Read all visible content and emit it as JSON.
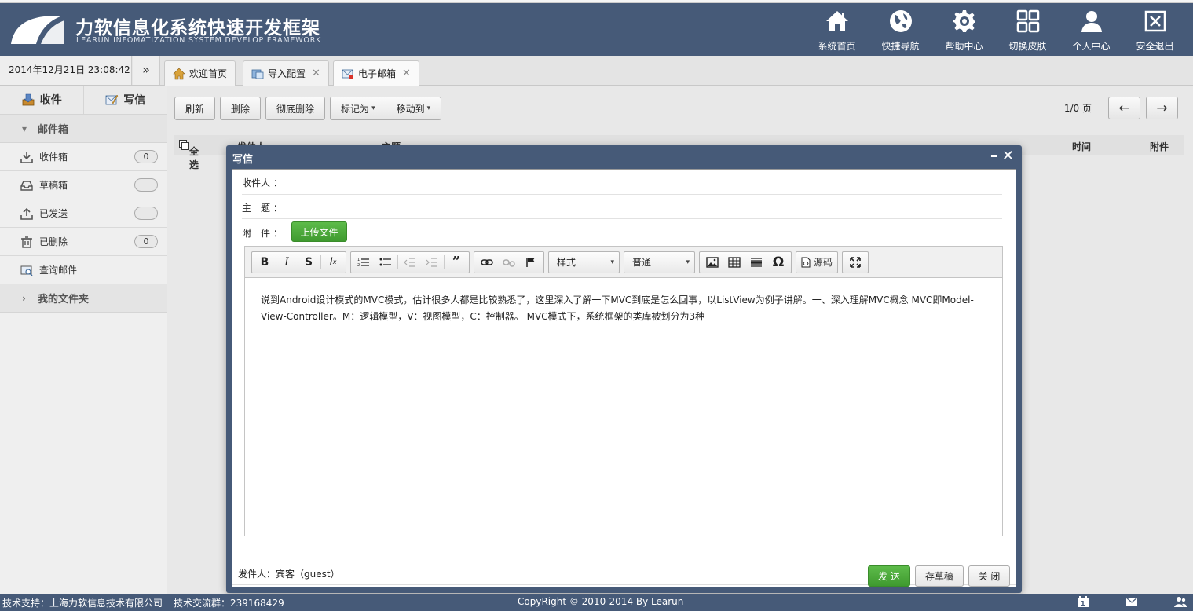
{
  "app": {
    "title_cn": "力软信息化系统快速开发框架",
    "title_en": "LEARUN INFOMATIZATION SYSTEM DEVELOP FRAMEWORK"
  },
  "nav": [
    {
      "label": "系统首页",
      "icon": "home-icon"
    },
    {
      "label": "快捷导航",
      "icon": "globe-icon"
    },
    {
      "label": "帮助中心",
      "icon": "gear-icon"
    },
    {
      "label": "切换皮肤",
      "icon": "grid-icon"
    },
    {
      "label": "个人中心",
      "icon": "user-icon"
    },
    {
      "label": "安全退出",
      "icon": "exit-icon"
    }
  ],
  "datetime": "2014年12月21日 23:08:42",
  "tabs": [
    {
      "label": "欢迎首页",
      "icon": "house-icon"
    },
    {
      "label": "导入配置",
      "icon": "import-icon"
    },
    {
      "label": "电子邮箱",
      "icon": "mail-icon"
    }
  ],
  "sidebar": {
    "receive": "收件",
    "write": "写信",
    "mailbox_section": "邮件箱",
    "items": [
      {
        "label": "收件箱",
        "badge": "0"
      },
      {
        "label": "草稿箱",
        "badge": ""
      },
      {
        "label": "已发送",
        "badge": ""
      },
      {
        "label": "已删除",
        "badge": "0"
      },
      {
        "label": "查询邮件",
        "badge": null
      }
    ],
    "folder_section": "我的文件夹"
  },
  "toolbar": {
    "refresh": "刷新",
    "delete": "删除",
    "purge": "彻底删除",
    "mark_as": "标记为",
    "move_to": "移动到"
  },
  "pager": {
    "text": "1/0 页"
  },
  "grid": {
    "select_all": "全选",
    "col_sender": "发件人",
    "col_subject": "主题",
    "col_time": "时间",
    "col_attach": "附件"
  },
  "dialog": {
    "title": "写信",
    "to_label": "收件人 ：",
    "subject_label": "主　题 ：",
    "attach_label": "附　件 ：",
    "upload": "上传文件",
    "style_combo": "样式",
    "format_combo": "普通",
    "source": "源码",
    "content": "说到Android设计模式的MVC模式，估计很多人都是比较熟悉了，这里深入了解一下MVC到底是怎么回事，以ListView为例子讲解。一、深入理解MVC概念 MVC即Model-View-Controller。M：逻辑模型，V：视图模型，C：控制器。 MVC模式下，系统框架的类库被划分为3种",
    "sender": "发件人：宾客（guest）",
    "send": "发 送",
    "save_draft": "存草稿",
    "close": "关 闭"
  },
  "footer": {
    "support": "技术支持：上海力软信息技术有限公司",
    "group": "技术交流群：239168429",
    "copyright": "CopyRight © 2010-2014 By Learun"
  },
  "colors": {
    "header_bg": "#465a78",
    "accent_green": "#4cae3b"
  }
}
